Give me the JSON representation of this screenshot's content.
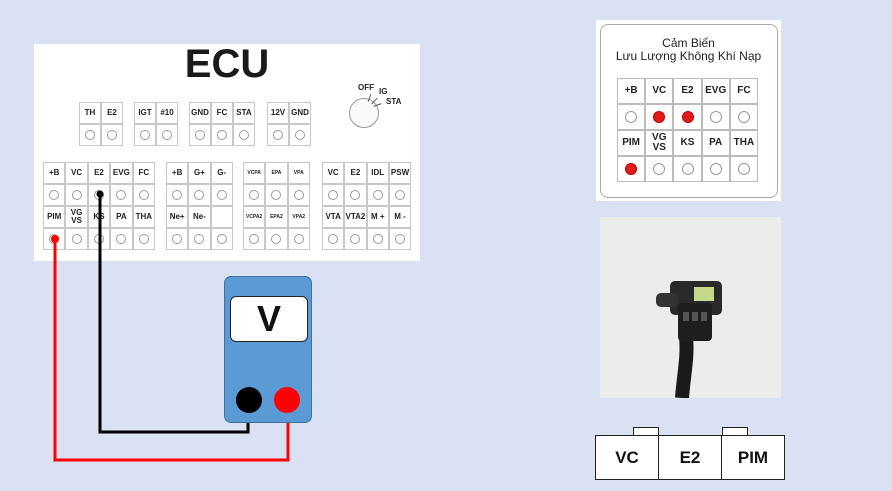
{
  "ecu": {
    "title": "ECU",
    "top_groups": [
      {
        "labels": [
          "TH",
          "E2"
        ]
      },
      {
        "labels": [
          "IGT",
          "#10"
        ]
      },
      {
        "labels": [
          "GND",
          "FC",
          "STA"
        ]
      },
      {
        "labels": [
          "12V",
          "GND"
        ]
      }
    ],
    "switch_labels": {
      "off": "OFF",
      "ig": "IG",
      "sta": "STA"
    },
    "bottom_groups": [
      {
        "row1": [
          "+B",
          "VC",
          "E2",
          "EVG",
          "FC"
        ],
        "row2": [
          "PIM",
          "VG VS",
          "KS",
          "PA",
          "THA"
        ]
      },
      {
        "row1": [
          "+B",
          "G+",
          "G-"
        ],
        "row2": [
          "Ne+",
          "Ne-",
          ""
        ]
      },
      {
        "row1": [
          "VCPA",
          "EPA",
          "VPA"
        ],
        "row2": [
          "VCPA2",
          "EPA2",
          "VPA2"
        ]
      },
      {
        "row1": [
          "VC",
          "E2",
          "IDL",
          "PSW"
        ],
        "row2": [
          "VTA",
          "VTA2",
          "M +",
          "M -"
        ]
      }
    ]
  },
  "meter": {
    "label": "V"
  },
  "sensor": {
    "title_line1": "Cảm Biến",
    "title_line2": "Lưu Lượng Không Khí Nạp",
    "row1": [
      "+B",
      "VC",
      "E2",
      "EVG",
      "FC"
    ],
    "row1_pins_red": [
      false,
      true,
      true,
      false,
      false
    ],
    "row2": [
      "PIM",
      "VG VS",
      "KS",
      "PA",
      "THA"
    ],
    "row2_pins_red": [
      true,
      false,
      false,
      false,
      false
    ]
  },
  "connector": {
    "pins": [
      "VC",
      "E2",
      "PIM"
    ]
  },
  "colors": {
    "background": "#d9e1f2",
    "meter_body": "#5b9bd5",
    "probe_red": "#ff0000",
    "probe_black": "#000000",
    "pin_red": "#e21a1a"
  }
}
